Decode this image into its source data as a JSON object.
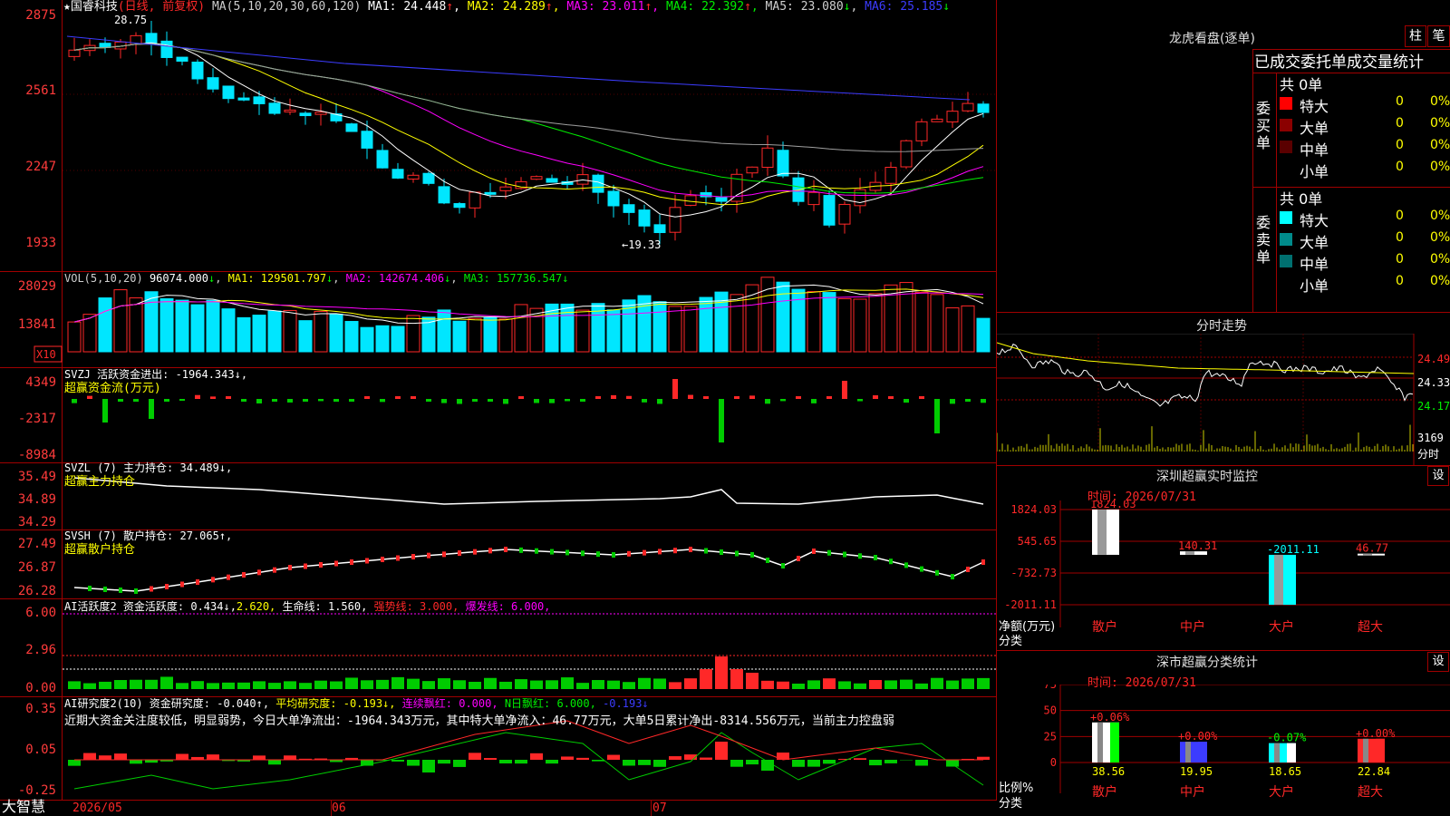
{
  "app": {
    "brand": "大智慧"
  },
  "colors": {
    "up": "#ff2828",
    "down": "#00e6ff",
    "grid": "#a00000",
    "ma1": "#ffffff",
    "ma2": "#ffff00",
    "ma3": "#ff00ff",
    "ma4": "#00ee00",
    "ma5": "#a0a0a0",
    "ma6": "#3c3cff"
  },
  "header": {
    "name": "★国睿科技",
    "period": "(日线, 前复权)",
    "ma_spec": "MA(5,10,20,30,60,120)",
    "ma": [
      {
        "label": "MA1:",
        "value": "24.448",
        "arrow": "↑"
      },
      {
        "label": "MA2:",
        "value": "24.289",
        "arrow": "↑"
      },
      {
        "label": "MA3:",
        "value": "23.011",
        "arrow": "↑"
      },
      {
        "label": "MA4:",
        "value": "22.392",
        "arrow": "↑"
      },
      {
        "label": "MA5:",
        "value": "23.080",
        "arrow": "↓"
      },
      {
        "label": "MA6:",
        "value": "25.185",
        "arrow": "↓"
      }
    ]
  },
  "panels": {
    "price": {
      "yticks": [
        "2875",
        "2561",
        "2247",
        "1933"
      ],
      "high_mark": "28.75",
      "low_mark": "←19.33"
    },
    "vol": {
      "yticks": [
        "28029",
        "13841"
      ],
      "unit": "X10",
      "title": "VOL(5,10,20)",
      "value": "96074.000",
      "value_arrow": "↓",
      "ma": [
        {
          "label": "MA1:",
          "value": "129501.797",
          "arrow": "↓"
        },
        {
          "label": "MA2:",
          "value": "142674.406",
          "arrow": "↓"
        },
        {
          "label": "MA3:",
          "value": "157736.547",
          "arrow": "↓"
        }
      ]
    },
    "svzj": {
      "yticks": [
        "4349",
        "-2317",
        "-8984"
      ],
      "title": "SVZJ  活跃资金进出: -1964.343↓,",
      "subtitle": "超赢资金流(万元)"
    },
    "svzl": {
      "yticks": [
        "35.49",
        "34.89",
        "34.29"
      ],
      "title": "SVZL (7) 主力持仓: 34.489↓,",
      "subtitle": "超赢主力持仓"
    },
    "svsh": {
      "yticks": [
        "27.49",
        "26.87",
        "26.28"
      ],
      "title": "SVSH (7) 散户持仓: 27.065↑,",
      "subtitle": "超赢散户持仓"
    },
    "ai_active": {
      "yticks": [
        "6.00",
        "2.96",
        "0.00"
      ],
      "t1": "AI活跃度2 资金活跃度: 0.434↓,",
      "t2": "2.620,",
      "t3": "生命线: 1.560,",
      "t4": "强势线: 3.000,",
      "t5": "爆发线: 6.000,"
    },
    "ai_research": {
      "yticks": [
        "0.35",
        "0.05",
        "-0.25"
      ],
      "t1": "AI研究度2(10) 资金研究度: -0.040↑,",
      "t2": "平均研究度: -0.193↓,",
      "t3": "连续飘红: 0.000,",
      "t4": "N日飘红: 6.000,",
      "t5": "-0.193↓",
      "comment": "近期大资金关注度较低，明显弱势，今日大单净流出：-1964.343万元，其中特大单净流入：46.77万元，大单5日累计净出-8314.556万元，当前主力控盘弱"
    }
  },
  "xaxis": {
    "labels": [
      "2026/05",
      "06",
      "07"
    ]
  },
  "right": {
    "longhu": {
      "title": "龙虎看盘(逐单)",
      "btn1": "柱",
      "btn2": "笔",
      "header": "已成交委托单成交量统计",
      "buy": {
        "side": "委买单",
        "total": "共 0单",
        "rows": [
          {
            "label": "特大",
            "n": "0",
            "pct": "0%"
          },
          {
            "label": "大单",
            "n": "0",
            "pct": "0%"
          },
          {
            "label": "中单",
            "n": "0",
            "pct": "0%"
          },
          {
            "label": "小单",
            "n": "0",
            "pct": "0%"
          }
        ]
      },
      "sell": {
        "side": "委卖单",
        "total": "共 0单",
        "rows": [
          {
            "label": "特大",
            "n": "0",
            "pct": "0%"
          },
          {
            "label": "大单",
            "n": "0",
            "pct": "0%"
          },
          {
            "label": "中单",
            "n": "0",
            "pct": "0%"
          },
          {
            "label": "小单",
            "n": "0",
            "pct": "0%"
          }
        ]
      }
    },
    "intraday": {
      "title": "分时走势",
      "prices": [
        "24.49",
        "24.33",
        "24.17"
      ],
      "vol": "3169",
      "vol_label": "分时"
    },
    "monitor": {
      "title": "深圳超赢实时监控",
      "btn": "设",
      "time": "时间: 2026/07/31",
      "yticks": [
        "1824.03",
        "545.65",
        "-732.73",
        "-2011.11"
      ],
      "ylabel1": "净额(万元)",
      "ylabel2": "分类",
      "cats": [
        "散户",
        "中户",
        "大户",
        "超大"
      ],
      "values": [
        1824.03,
        140.31,
        -2011.11,
        46.77
      ],
      "value_labels": [
        "1824.03",
        "140.31",
        "-2011.11",
        "46.77"
      ]
    },
    "classify": {
      "title": "深市超赢分类统计",
      "btn": "设",
      "time": "时间: 2026/07/31",
      "yticks": [
        "75",
        "50",
        "25",
        "0"
      ],
      "ylabel1": "比例%",
      "ylabel2": "分类",
      "cats": [
        "散户",
        "中户",
        "大户",
        "超大"
      ],
      "values": [
        38.56,
        19.95,
        18.65,
        22.84
      ],
      "value_labels": [
        "38.56",
        "19.95",
        "18.65",
        "22.84"
      ],
      "deltas": [
        "+0.06%",
        "+0.00%",
        "-0.07%",
        "+0.00%"
      ]
    }
  }
}
